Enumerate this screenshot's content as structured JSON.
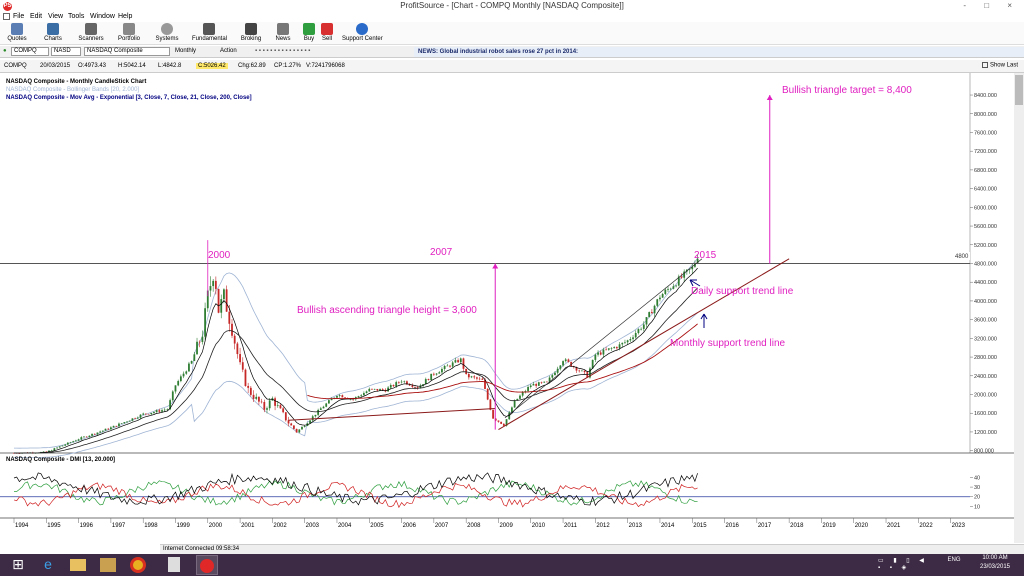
{
  "window": {
    "title": "ProfitSource - [Chart - COMPQ Monthly [NASDAQ Composite]]",
    "app_icon": "PS",
    "controls": "- □ ×"
  },
  "menu": [
    "File",
    "Edit",
    "View",
    "Tools",
    "Window",
    "Help"
  ],
  "toolbar": [
    "Quotes",
    "Charts",
    "Scanners",
    "Portfolio",
    "Systems",
    "Fundamental",
    "Broking",
    "News",
    "Buy",
    "Sell",
    "Support Center"
  ],
  "symbol_bar": {
    "symbol": "COMPQ",
    "exchange": "NASD",
    "name": "NASDAQ Composite",
    "period": "Monthly",
    "action": "Action",
    "news": "NEWS: Global industrial robot sales rose 27 pct in 2014:"
  },
  "info_bar": {
    "symbol": "COMPQ",
    "date": "20/03/2015",
    "open": "O:4973.43",
    "high": "H:5042.14",
    "low": "L:4842.8",
    "close": "C:5026.42",
    "change": "Chg:62.89",
    "change_pct": "CP:1.27%",
    "volume": "V:7241796068",
    "show_last": "Show Last"
  },
  "chart": {
    "legend": [
      {
        "text": "NASDAQ Composite - Monthly CandleStick Chart",
        "color": "#000000"
      },
      {
        "text": "NASDAQ Composite - Bollinger Bands [20, 2.000]",
        "color": "#9fb4d4"
      },
      {
        "text": "NASDAQ Composite - Mov Avg - Exponential [3, Close, 7, Close, 21, Close, 200, Close]",
        "color": "#000080"
      }
    ],
    "dmi_label": "NASDAQ Composite - DMI [13, 20.000]",
    "annotations": {
      "y2000": "2000",
      "y2007": "2007",
      "y2015": "2015",
      "triangle_height": "Bullish ascending triangle height = 3,600",
      "target": "Bullish triangle target = 8,400",
      "daily": "Daily support trend line",
      "monthly": "Monthly support trend line",
      "resistance_tag": "4800"
    },
    "colors": {
      "annotation": "#e020c0",
      "trend": "#8b1a1a",
      "up": "#2e7d32",
      "down": "#c62828"
    }
  },
  "chart_data": {
    "type": "candlestick",
    "title": "NASDAQ Composite - Monthly CandleStick Chart",
    "x": [
      "1994",
      "1995",
      "1996",
      "1997",
      "1998",
      "1999",
      "2000",
      "2001",
      "2002",
      "2003",
      "2004",
      "2005",
      "2006",
      "2007",
      "2008",
      "2009",
      "2010",
      "2011",
      "2012",
      "2013",
      "2014",
      "2015",
      "2016",
      "2017",
      "2018",
      "2019",
      "2020",
      "2021",
      "2022",
      "2023"
    ],
    "y_ticks": [
      "8400.000",
      "8000.000",
      "7600.000",
      "7200.000",
      "6800.000",
      "6400.000",
      "6000.000",
      "5600.000",
      "5200.000",
      "4800.000",
      "4400.000",
      "4000.000",
      "3600.000",
      "3200.000",
      "2800.000",
      "2400.000",
      "2000.000",
      "1600.000",
      "1200.000",
      "800.000"
    ],
    "ylim": [
      750,
      8700
    ],
    "series": [
      {
        "name": "NASDAQ Composite",
        "points": [
          [
            1994.0,
            750
          ],
          [
            1995.0,
            770
          ],
          [
            1996.0,
            1050
          ],
          [
            1997.0,
            1290
          ],
          [
            1998.0,
            1580
          ],
          [
            1998.75,
            1690
          ],
          [
            1999.0,
            2200
          ],
          [
            1999.5,
            2700
          ],
          [
            1999.83,
            3300
          ],
          [
            2000.0,
            4100
          ],
          [
            2000.2,
            4700
          ],
          [
            2000.33,
            3800
          ],
          [
            2000.5,
            4100
          ],
          [
            2000.75,
            3400
          ],
          [
            2001.0,
            2600
          ],
          [
            2001.25,
            2100
          ],
          [
            2001.75,
            1700
          ],
          [
            2002.0,
            1900
          ],
          [
            2002.5,
            1400
          ],
          [
            2002.75,
            1200
          ],
          [
            2003.0,
            1350
          ],
          [
            2003.5,
            1700
          ],
          [
            2004.0,
            2000
          ],
          [
            2004.5,
            1900
          ],
          [
            2005.0,
            2100
          ],
          [
            2005.5,
            2100
          ],
          [
            2006.0,
            2300
          ],
          [
            2006.5,
            2150
          ],
          [
            2007.0,
            2450
          ],
          [
            2007.83,
            2750
          ],
          [
            2008.0,
            2400
          ],
          [
            2008.5,
            2300
          ],
          [
            2008.83,
            1500
          ],
          [
            2009.17,
            1350
          ],
          [
            2009.5,
            1850
          ],
          [
            2010.0,
            2200
          ],
          [
            2010.5,
            2250
          ],
          [
            2011.0,
            2750
          ],
          [
            2011.75,
            2400
          ],
          [
            2012.0,
            2850
          ],
          [
            2012.75,
            3050
          ],
          [
            2013.0,
            3150
          ],
          [
            2013.5,
            3500
          ],
          [
            2014.0,
            4100
          ],
          [
            2014.5,
            4400
          ],
          [
            2015.0,
            4700
          ],
          [
            2015.2,
            5026
          ]
        ]
      }
    ],
    "levels": {
      "resistance": 4800,
      "target": 8400,
      "triangle_height": 3600
    },
    "dmi": {
      "ylim": [
        0,
        55
      ],
      "y_ticks": [
        "40",
        "30",
        "20",
        "10"
      ]
    }
  },
  "status": {
    "text": "Internet Connected 09:58:34"
  },
  "taskbar": {
    "tray_lang": "ENG",
    "time": "10:00 AM",
    "date": "23/03/2015"
  }
}
